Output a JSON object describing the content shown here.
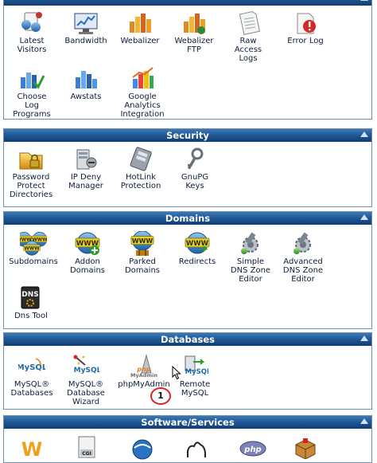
{
  "colors": {
    "header_bg": "#1c5390",
    "header_text": "#ffffff",
    "border": "#6f8fb1",
    "label": "#0f1d3a"
  },
  "logs": {
    "items": [
      {
        "label": "Latest\nVisitors",
        "icon": "visitors-icon"
      },
      {
        "label": "Bandwidth",
        "icon": "bandwidth-icon"
      },
      {
        "label": "Webalizer",
        "icon": "webalizer-icon"
      },
      {
        "label": "Webalizer\nFTP",
        "icon": "webalizer-ftp-icon"
      },
      {
        "label": "Raw\nAccess\nLogs",
        "icon": "raw-logs-icon"
      },
      {
        "label": "Error Log",
        "icon": "error-log-icon"
      },
      {
        "label": "Choose\nLog\nPrograms",
        "icon": "log-programs-icon"
      },
      {
        "label": "Awstats",
        "icon": "awstats-icon"
      },
      {
        "label": "Google\nAnalytics\nIntegration",
        "icon": "google-analytics-icon"
      }
    ]
  },
  "security": {
    "title": "Security",
    "items": [
      {
        "label": "Password\nProtect\nDirectories",
        "icon": "folder-lock-icon"
      },
      {
        "label": "IP Deny\nManager",
        "icon": "ip-deny-icon"
      },
      {
        "label": "HotLink\nProtection",
        "icon": "hotlink-icon"
      },
      {
        "label": "GnuPG\nKeys",
        "icon": "keys-icon"
      }
    ]
  },
  "domains": {
    "title": "Domains",
    "items": [
      {
        "label": "Subdomains",
        "icon": "subdomains-icon"
      },
      {
        "label": "Addon\nDomains",
        "icon": "addon-domains-icon"
      },
      {
        "label": "Parked\nDomains",
        "icon": "parked-domains-icon"
      },
      {
        "label": "Redirects",
        "icon": "redirects-icon"
      },
      {
        "label": "Simple\nDNS Zone\nEditor",
        "icon": "dns-simple-icon"
      },
      {
        "label": "Advanced\nDNS Zone\nEditor",
        "icon": "dns-advanced-icon"
      },
      {
        "label": "Dns Tool",
        "icon": "dns-tool-icon"
      }
    ]
  },
  "databases": {
    "title": "Databases",
    "items": [
      {
        "label": "MySQL®\nDatabases",
        "icon": "mysql-icon"
      },
      {
        "label": "MySQL®\nDatabase\nWizard",
        "icon": "mysql-wizard-icon"
      },
      {
        "label": "phpMyAdmin",
        "icon": "phpmyadmin-icon"
      },
      {
        "label": "Remote\nMySQL",
        "icon": "remote-mysql-icon"
      }
    ],
    "annotation": "1"
  },
  "software": {
    "title": "Software/Services"
  }
}
